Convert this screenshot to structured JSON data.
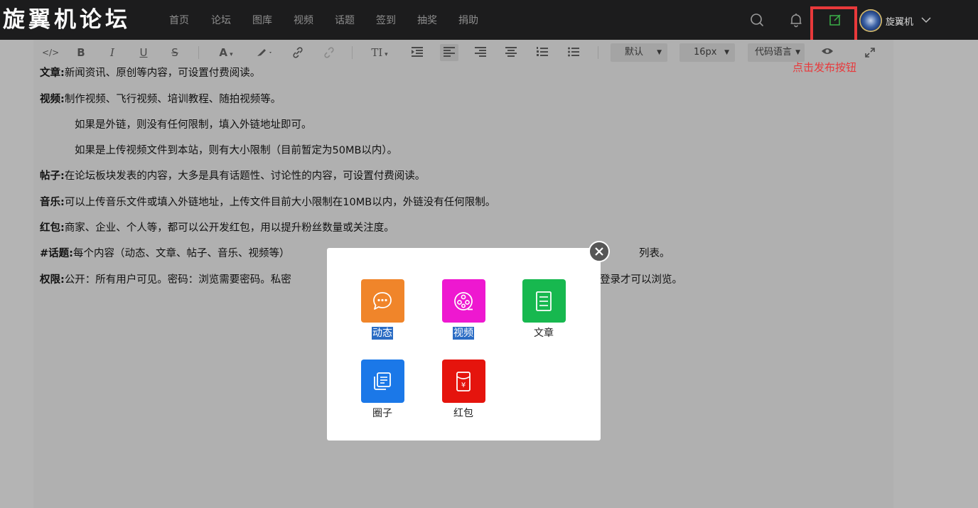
{
  "site": {
    "logo_text": "旋翼机论坛"
  },
  "nav": {
    "items": [
      "首页",
      "论坛",
      "图库",
      "视频",
      "话题",
      "签到",
      "抽奖",
      "捐助"
    ]
  },
  "user": {
    "name": "旋翼机",
    "avatar_icon": "badge-avatar"
  },
  "header_icons": [
    "search-icon",
    "bell-icon",
    "edit-square-icon",
    "chevron-down-icon"
  ],
  "annotation": {
    "hint": "点击发布按钮",
    "color": "#e8393b"
  },
  "toolbar": {
    "bold": "B",
    "italic": "I",
    "underline": "U",
    "strike": "S",
    "font_color": "A",
    "heading": "TI",
    "font_family": "默认",
    "font_size": "16px",
    "code_language": "代码语言"
  },
  "content": {
    "article_label": "文章:",
    "article_text": "新闻资讯、原创等内容，可设置付费阅读。",
    "video_label": "视频:",
    "video_text": "制作视频、飞行视频、培训教程、随拍视频等。",
    "video_note1": "如果是外链，则没有任何限制，填入外链地址即可。",
    "video_note2": "如果是上传视频文件到本站，则有大小限制（目前暂定为50MB以内）。",
    "post_label": "帖子:",
    "post_text": "在论坛板块发表的内容，大多是具有话题性、讨论性的内容，可设置付费阅读。",
    "music_label": "音乐:",
    "music_text": "可以上传音乐文件或填入外链地址，上传文件目前大小限制在10MB以内，外链没有任何限制。",
    "redpacket_label": "红包:",
    "redpacket_text": "商家、企业、个人等，都可以公开发红包，用以提升粉丝数量或关注度。",
    "topic_label": "#话题:",
    "topic_text": "每个内容（动态、文章、帖子、音乐、视频等）",
    "topic_tail": "列表。",
    "perm_label": "权限:",
    "perm_text": "公开：所有用户可见。密码：浏览需要密码。私密",
    "perm_tail": "登录才可以浏览。"
  },
  "modal": {
    "tiles": [
      {
        "label": "动态",
        "color": "#f0852a",
        "icon": "chat-bubble-icon",
        "selected": true
      },
      {
        "label": "视频",
        "color": "#ee18d0",
        "icon": "film-reel-icon",
        "selected": true
      },
      {
        "label": "文章",
        "color": "#17b84f",
        "icon": "document-icon",
        "selected": false
      },
      {
        "label": "圈子",
        "color": "#1b78e8",
        "icon": "stacked-docs-icon",
        "selected": false
      },
      {
        "label": "红包",
        "color": "#e5140d",
        "icon": "red-envelope-icon",
        "selected": false
      }
    ]
  }
}
